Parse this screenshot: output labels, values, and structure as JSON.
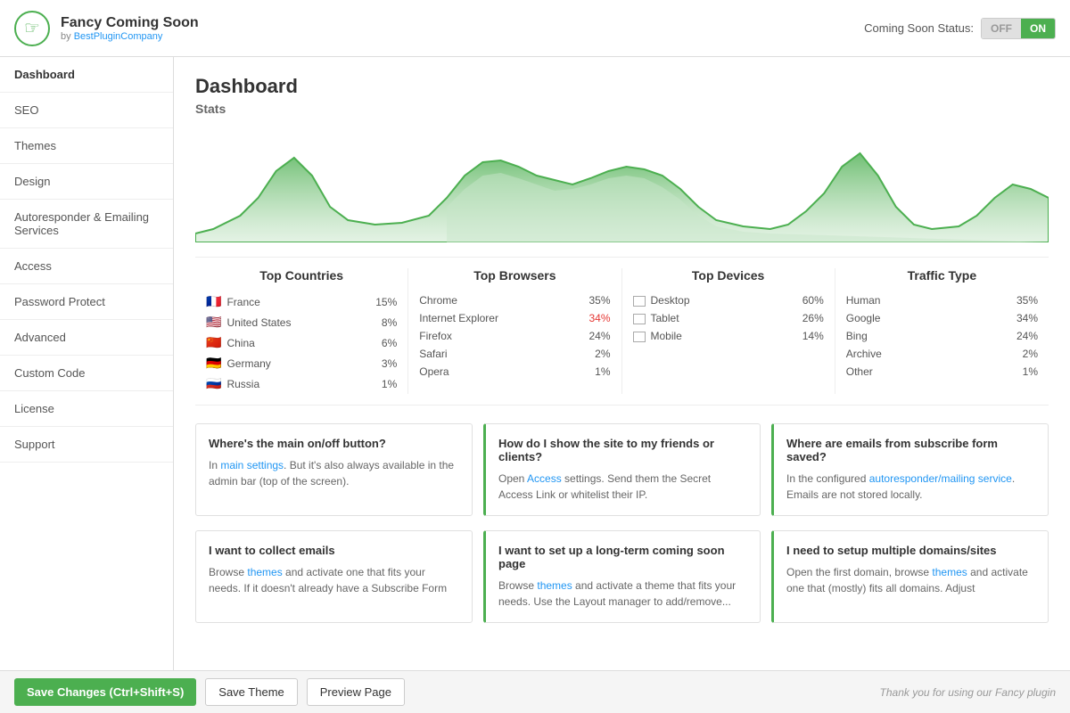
{
  "header": {
    "logo_symbol": "☞",
    "app_title": "Fancy Coming Soon",
    "app_subtitle_prefix": "by ",
    "app_subtitle_link": "BestPluginCompany",
    "status_label": "Coming Soon Status:",
    "toggle_off": "OFF",
    "toggle_on": "ON"
  },
  "sidebar": {
    "items": [
      {
        "id": "dashboard",
        "label": "Dashboard",
        "active": true
      },
      {
        "id": "seo",
        "label": "SEO",
        "active": false
      },
      {
        "id": "themes",
        "label": "Themes",
        "active": false
      },
      {
        "id": "design",
        "label": "Design",
        "active": false
      },
      {
        "id": "autoresponder",
        "label": "Autoresponder & Emailing Services",
        "active": false
      },
      {
        "id": "access",
        "label": "Access",
        "active": false
      },
      {
        "id": "password",
        "label": "Password Protect",
        "active": false
      },
      {
        "id": "advanced",
        "label": "Advanced",
        "active": false
      },
      {
        "id": "custom-code",
        "label": "Custom Code",
        "active": false
      },
      {
        "id": "license",
        "label": "License",
        "active": false
      },
      {
        "id": "support",
        "label": "Support",
        "active": false
      }
    ]
  },
  "main": {
    "page_title": "Dashboard",
    "stats_subtitle": "Stats",
    "top_countries": {
      "title": "Top Countries",
      "rows": [
        {
          "flag": "🇫🇷",
          "name": "France",
          "pct": "15%"
        },
        {
          "flag": "🇺🇸",
          "name": "United States",
          "pct": "8%"
        },
        {
          "flag": "🇨🇳",
          "name": "China",
          "pct": "6%"
        },
        {
          "flag": "🇩🇪",
          "name": "Germany",
          "pct": "3%"
        },
        {
          "flag": "🇷🇺",
          "name": "Russia",
          "pct": "1%"
        }
      ]
    },
    "top_browsers": {
      "title": "Top Browsers",
      "rows": [
        {
          "name": "Chrome",
          "pct": "35%"
        },
        {
          "name": "Internet Explorer",
          "pct": "34%"
        },
        {
          "name": "Firefox",
          "pct": "24%"
        },
        {
          "name": "Safari",
          "pct": "2%"
        },
        {
          "name": "Opera",
          "pct": "1%"
        }
      ]
    },
    "top_devices": {
      "title": "Top Devices",
      "rows": [
        {
          "name": "Desktop",
          "pct": "60%"
        },
        {
          "name": "Tablet",
          "pct": "26%"
        },
        {
          "name": "Mobile",
          "pct": "14%"
        }
      ]
    },
    "traffic_type": {
      "title": "Traffic Type",
      "rows": [
        {
          "name": "Human",
          "pct": "35%"
        },
        {
          "name": "Google",
          "pct": "34%"
        },
        {
          "name": "Bing",
          "pct": "24%"
        },
        {
          "name": "Archive",
          "pct": "2%"
        },
        {
          "name": "Other",
          "pct": "1%"
        }
      ]
    },
    "cards_row1": [
      {
        "title": "Where's the main on/off button?",
        "text_before": "In ",
        "link_text": "main settings",
        "text_after": ". But it's also always available in the admin bar (top of the screen).",
        "has_green_border": false
      },
      {
        "title": "How do I show the site to my friends or clients?",
        "text_before": "Open ",
        "link_text": "Access",
        "text_after": " settings. Send them the Secret Access Link or whitelist their IP.",
        "has_green_border": true
      },
      {
        "title": "Where are emails from subscribe form saved?",
        "text_before": "In the configured ",
        "link_text": "autoresponder/mailing service",
        "text_after": ". Emails are not stored locally.",
        "has_green_border": true
      }
    ],
    "cards_row2": [
      {
        "title": "I want to collect emails",
        "text_before": "Browse ",
        "link_text": "themes",
        "text_after": " and activate one that fits your needs. If it doesn't already have a Subscribe Form",
        "has_green_border": false
      },
      {
        "title": "I want to set up a long-term coming soon page",
        "text_before": "Browse ",
        "link_text": "themes",
        "text_after": " and activate a theme that fits your needs. Use the Layout manager to add/remove...",
        "has_green_border": true
      },
      {
        "title": "I need to setup multiple domains/sites",
        "text_before": "Open the first domain, browse ",
        "link_text": "themes",
        "text_after": " and activate one that (mostly) fits all domains. Adjust",
        "has_green_border": true
      }
    ]
  },
  "footer": {
    "save_changes_label": "Save Changes (Ctrl+Shift+S)",
    "save_theme_label": "Save Theme",
    "preview_page_label": "Preview Page",
    "thanks_text": "Thank you for using our Fancy plugin"
  }
}
